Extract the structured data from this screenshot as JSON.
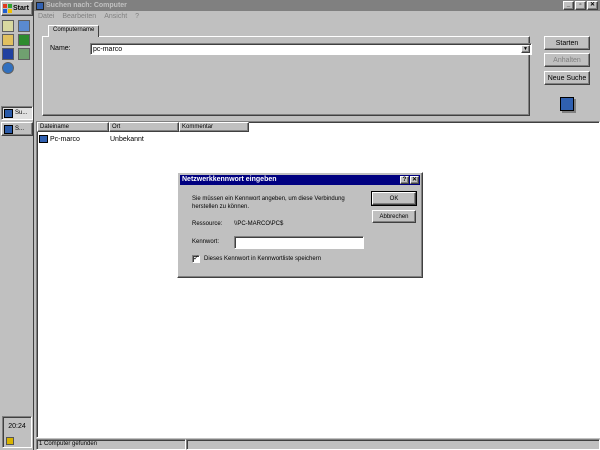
{
  "taskbar": {
    "start_label": "Start",
    "quicklaunch": [
      "mycomputer-icon",
      "ie-icon",
      "outlook-icon",
      "excel-icon",
      "word-icon",
      "chart-icon",
      "network-icon"
    ],
    "tasks": [
      {
        "label": "Su..."
      },
      {
        "label": "S..."
      }
    ],
    "clock": "20:24"
  },
  "window": {
    "title": "Suchen nach: Computer",
    "menus": [
      "Datei",
      "Bearbeiten",
      "Ansicht",
      "?"
    ],
    "tab_label": "Computername",
    "name_label": "Name:",
    "name_value": "pc-marco",
    "buttons": {
      "search": "Starten",
      "stop": "Anhalten",
      "new_search": "Neue Suche"
    }
  },
  "results": {
    "columns": [
      "Dateiname",
      "Ort",
      "Kommentar"
    ],
    "rows": [
      {
        "name": "Pc-marco",
        "location": "Unbekannt",
        "comment": ""
      }
    ]
  },
  "status": {
    "text": "1 Computer gefunden"
  },
  "dialog": {
    "title": "Netzwerkkennwort eingeben",
    "message": "Sie müssen ein Kennwort angeben, um diese Verbindung herstellen zu können.",
    "resource_label": "Ressource:",
    "resource_value": "\\\\PC-MARCO\\PC$",
    "password_label": "Kennwort:",
    "password_value": "",
    "save_checkbox_checked": true,
    "save_label": "Dieses Kennwort in Kennwortliste speichern",
    "ok": "OK",
    "cancel": "Abbrechen"
  },
  "colors": {
    "titlebar_active": "#000080",
    "titlebar_inactive": "#808080",
    "face": "#c0c0c0"
  }
}
